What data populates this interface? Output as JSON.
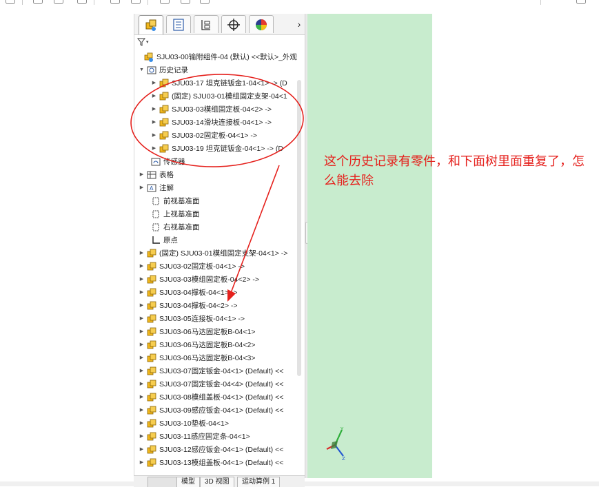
{
  "toolbar": {
    "icons": [
      "sketch-icon",
      "zoom-fit-icon",
      "zoom-area-icon",
      "section-view-icon",
      "view-orientation-icon",
      "display-style-icon",
      "hide-show-icon",
      "edit-appearance-icon",
      "scene-icon",
      "view-settings-icon"
    ]
  },
  "panel": {
    "tabs": [
      "feature-manager",
      "property-manager",
      "configuration-manager",
      "dimxpert-manager",
      "display-manager"
    ],
    "more_label": "›",
    "filter_label": "▾"
  },
  "tree": {
    "root_label": "SJU03-00输附组件-04 (默认) <<默认>_外观",
    "history": {
      "label": "历史记录",
      "items": [
        "SJU03-17 坦克链钣金1-04<1> -> (D",
        "(固定) SJU03-01模组固定支架-04<1",
        "SJU03-03模组固定板-04<2> ->",
        "SJU03-14滑块连接板-04<1> ->",
        "SJU03-02固定板-04<1> ->",
        "SJU03-19 坦克链钣金-04<1> -> (D"
      ]
    },
    "sensors_label": "传感器",
    "tables_label": "表格",
    "annotations_label": "注解",
    "planes": [
      "前视基准面",
      "上视基准面",
      "右视基准面"
    ],
    "origin_label": "原点",
    "components": [
      "(固定) SJU03-01模组固定支架-04<1> ->",
      "SJU03-02固定板-04<1> ->",
      "SJU03-03模组固定板-04<2> ->",
      "SJU03-04撑板-04<1> ->",
      "SJU03-04撑板-04<2> ->",
      "SJU03-05连接板-04<1> ->",
      "SJU03-06马达固定板B-04<1>",
      "SJU03-06马达固定板B-04<2>",
      "SJU03-06马达固定板B-04<3>",
      "SJU03-07固定钣金-04<1> (Default) <<",
      "SJU03-07固定钣金-04<4> (Default) <<",
      "SJU03-08模组盖板-04<1> (Default) <<",
      "SJU03-09感应钣金-04<1> (Default) <<",
      "SJU03-10垫板-04<1>",
      "SJU03-11感应固定条-04<1>",
      "SJU03-12感应钣金-04<1> (Default) <<",
      "SJU03-13模组盖板-04<1> (Default) <<"
    ]
  },
  "bottom_tabs": [
    "模型",
    "3D 视图",
    "运动算例 1"
  ],
  "annotation": {
    "text": "这个历史记录有零件，和下面树里面重复了，怎么能去除",
    "color": "#e5211d"
  },
  "colors": {
    "viewport": "#c8ecce",
    "annotation_red": "#e5211d",
    "part_yellow": "#f2b81d"
  }
}
